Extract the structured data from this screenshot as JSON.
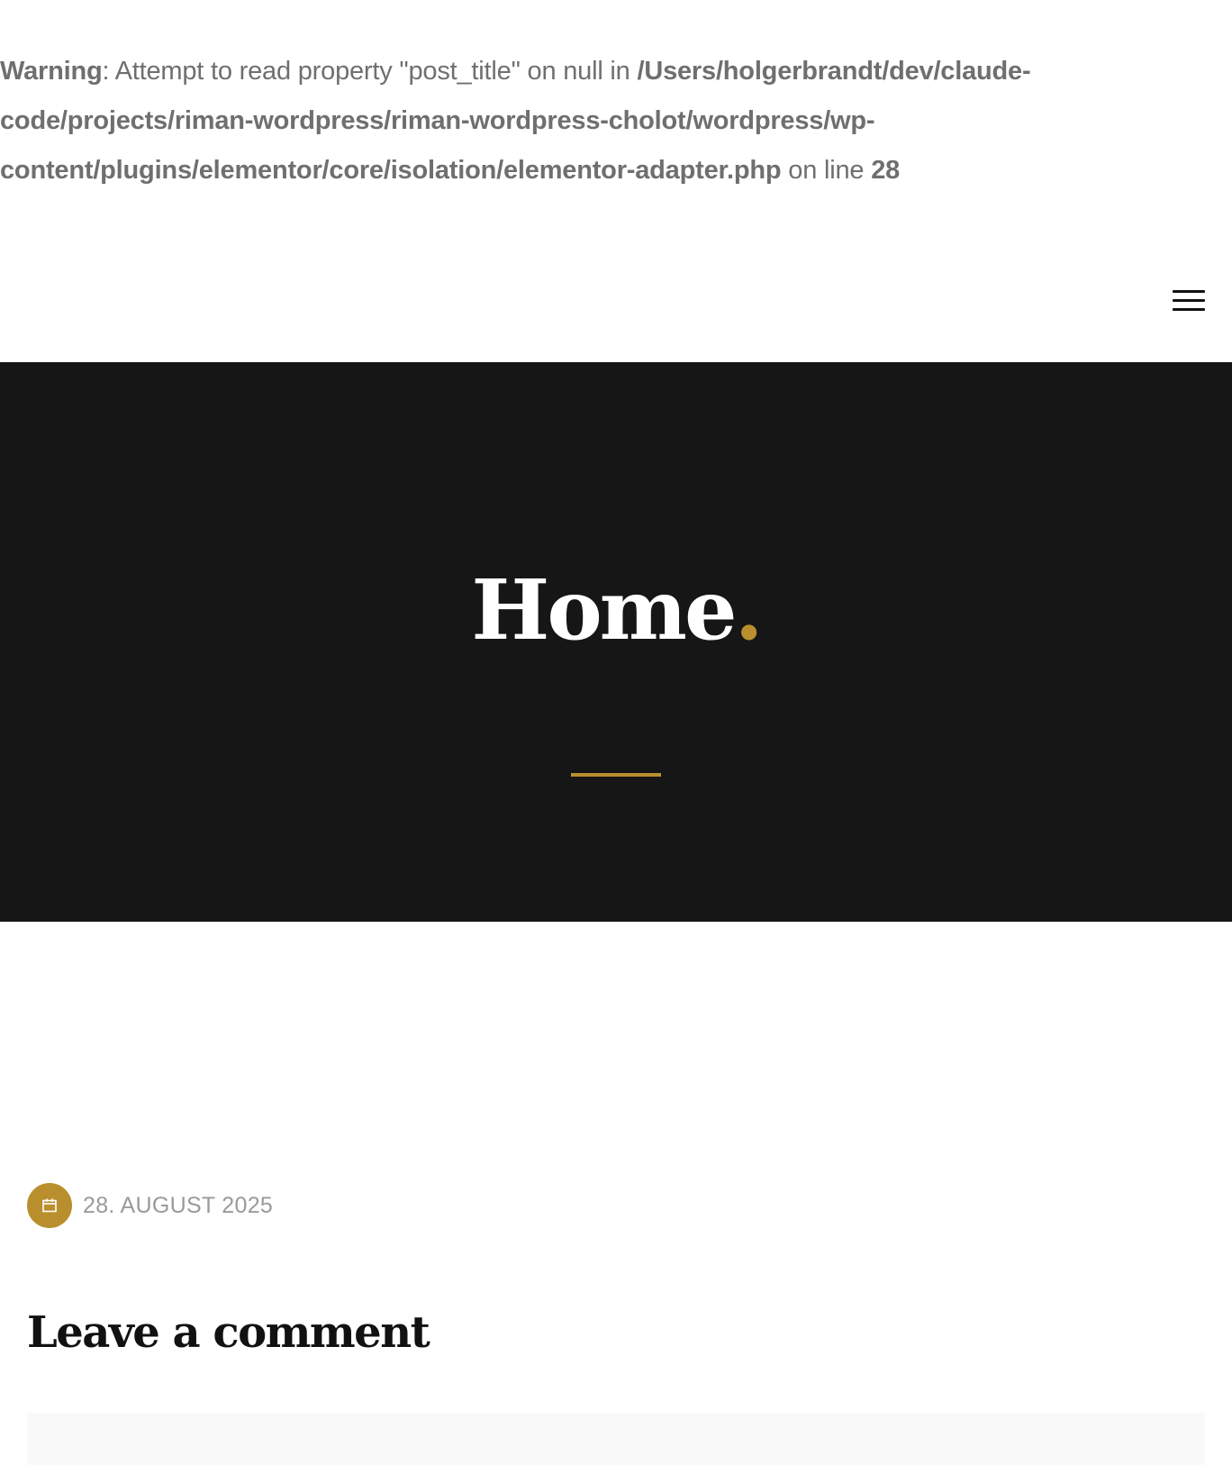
{
  "warning": {
    "label": "Warning",
    "message": ": Attempt to read property \"post_title\" on null in ",
    "path": "/Users/holgerbrandt/dev/claude-code/projects/riman-wordpress/riman-wordpress-cholot/wordpress/wp-content/plugins/elementor/core/isolation/elementor-adapter.php",
    "line_text": " on line ",
    "line_number": "28"
  },
  "header": {
    "menu_icon": "hamburger-menu-icon"
  },
  "hero": {
    "title": "Home",
    "title_dot": ".",
    "accent_color": "#b98f2e",
    "background_color": "#161616"
  },
  "post_meta": {
    "date_icon": "calendar-icon",
    "date": "28. AUGUST 2025"
  },
  "comments": {
    "title": "Leave a comment"
  }
}
